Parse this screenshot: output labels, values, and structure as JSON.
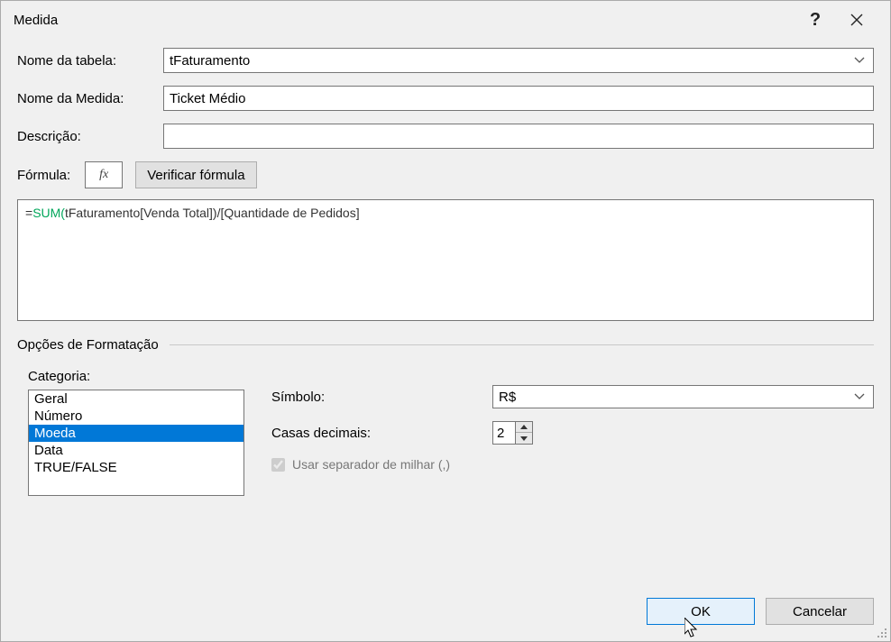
{
  "title": "Medida",
  "labels": {
    "table_name": "Nome da tabela:",
    "measure_name": "Nome da Medida:",
    "description": "Descrição:",
    "formula": "Fórmula:",
    "verify": "Verificar fórmula",
    "fx": "fx",
    "formatting_options": "Opções de Formatação",
    "category": "Categoria:",
    "symbol": "Símbolo:",
    "decimals": "Casas decimais:",
    "thousand_sep": "Usar separador de milhar (,)",
    "ok": "OK",
    "cancel": "Cancelar"
  },
  "values": {
    "table_name": "tFaturamento",
    "measure_name": "Ticket Médio",
    "description": "",
    "symbol": "R$",
    "decimals": "2",
    "thousand_sep_checked": true
  },
  "formula": {
    "eq": "=",
    "func": "SUM(",
    "rest": "tFaturamento[Venda Total])/[Quantidade de Pedidos]"
  },
  "categories": [
    "Geral",
    "Número",
    "Moeda",
    "Data",
    "TRUE/FALSE"
  ],
  "selected_category_index": 2
}
